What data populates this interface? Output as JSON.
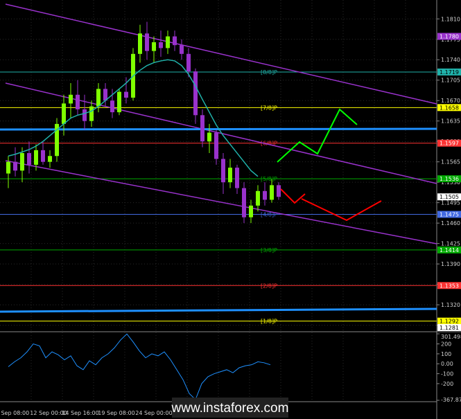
{
  "watermark": "www.instaforex.com",
  "colors": {
    "background": "#000000",
    "grid": "#2a2a2a",
    "bull_candle": "#7fff00",
    "bear_candle": "#9932cc",
    "ma": "#20b2aa",
    "channel": "#9932cc",
    "hline": "#1e90ff",
    "arrow_up": "#00ff00",
    "arrow_down": "#ff0000",
    "cci_line": "#1e90ff"
  },
  "chart_data": {
    "type": "candlestick",
    "price_axis": {
      "ticks": [
        "1.1810",
        "1.1775",
        "1.1740",
        "1.1705",
        "1.1670",
        "1.1635",
        "1.1600",
        "1.1565",
        "1.1530",
        "1.1495",
        "1.1460",
        "1.1425",
        "1.1390",
        "1.1355",
        "1.1320",
        "1.1285"
      ],
      "range": [
        1.1275,
        1.184
      ]
    },
    "time_axis": {
      "ticks": [
        "6 Sep 08:00",
        "12 Sep 00:00",
        "14 Sep 16:00",
        "19 Sep 08:00",
        "24 Sep 00:00"
      ]
    },
    "murray_levels": [
      {
        "label": "[8/8]P",
        "price": 1.1719,
        "color": "#20b2aa",
        "tag": "1.1719"
      },
      {
        "label": "[7/8]P",
        "price": 1.1658,
        "color": "#ffff00",
        "tag": "1.1658"
      },
      {
        "label": "[6/8]P",
        "price": 1.1597,
        "color": "#ff3333",
        "tag": "1.1597"
      },
      {
        "label": "[5/8]P",
        "price": 1.1536,
        "color": "#00aa00",
        "tag": "1.1536"
      },
      {
        "label": "[4/8]P",
        "price": 1.1475,
        "color": "#4169e1",
        "tag": "1.1475"
      },
      {
        "label": "[3/8]P",
        "price": 1.1414,
        "color": "#00aa00",
        "tag": "1.1414"
      },
      {
        "label": "[2/8]P",
        "price": 1.1353,
        "color": "#ff3333",
        "tag": "1.1353"
      },
      {
        "label": "[1/8]P",
        "price": 1.1292,
        "color": "#ffff00",
        "tag": "1.1292"
      }
    ],
    "extra_tags": [
      {
        "price": 1.178,
        "text": "1.1780",
        "color": "#9932cc"
      },
      {
        "price": 1.1505,
        "text": "1.1505",
        "color": "#ffffff"
      },
      {
        "price": 1.1281,
        "text": "1.1281",
        "color": "#ffffff"
      }
    ],
    "candles": [
      {
        "o": 1.1545,
        "h": 1.1575,
        "l": 1.152,
        "c": 1.1565
      },
      {
        "o": 1.1565,
        "h": 1.159,
        "l": 1.154,
        "c": 1.155
      },
      {
        "o": 1.155,
        "h": 1.159,
        "l": 1.153,
        "c": 1.158
      },
      {
        "o": 1.158,
        "h": 1.16,
        "l": 1.1545,
        "c": 1.156
      },
      {
        "o": 1.156,
        "h": 1.1595,
        "l": 1.155,
        "c": 1.1585
      },
      {
        "o": 1.1585,
        "h": 1.16,
        "l": 1.156,
        "c": 1.1565
      },
      {
        "o": 1.1565,
        "h": 1.1585,
        "l": 1.1555,
        "c": 1.1575
      },
      {
        "o": 1.1575,
        "h": 1.164,
        "l": 1.1565,
        "c": 1.163
      },
      {
        "o": 1.163,
        "h": 1.168,
        "l": 1.161,
        "c": 1.1665
      },
      {
        "o": 1.1665,
        "h": 1.17,
        "l": 1.164,
        "c": 1.168
      },
      {
        "o": 1.168,
        "h": 1.1705,
        "l": 1.1645,
        "c": 1.1655
      },
      {
        "o": 1.1655,
        "h": 1.168,
        "l": 1.162,
        "c": 1.1635
      },
      {
        "o": 1.1635,
        "h": 1.167,
        "l": 1.1625,
        "c": 1.166
      },
      {
        "o": 1.166,
        "h": 1.17,
        "l": 1.165,
        "c": 1.169
      },
      {
        "o": 1.169,
        "h": 1.17,
        "l": 1.166,
        "c": 1.167
      },
      {
        "o": 1.167,
        "h": 1.169,
        "l": 1.164,
        "c": 1.165
      },
      {
        "o": 1.165,
        "h": 1.169,
        "l": 1.1645,
        "c": 1.1685
      },
      {
        "o": 1.1685,
        "h": 1.171,
        "l": 1.1665,
        "c": 1.1675
      },
      {
        "o": 1.1675,
        "h": 1.176,
        "l": 1.167,
        "c": 1.175
      },
      {
        "o": 1.175,
        "h": 1.18,
        "l": 1.1735,
        "c": 1.1785
      },
      {
        "o": 1.1785,
        "h": 1.1805,
        "l": 1.174,
        "c": 1.1755
      },
      {
        "o": 1.1755,
        "h": 1.178,
        "l": 1.1735,
        "c": 1.177
      },
      {
        "o": 1.177,
        "h": 1.179,
        "l": 1.1745,
        "c": 1.176
      },
      {
        "o": 1.176,
        "h": 1.179,
        "l": 1.175,
        "c": 1.178
      },
      {
        "o": 1.178,
        "h": 1.179,
        "l": 1.1755,
        "c": 1.1765
      },
      {
        "o": 1.1765,
        "h": 1.1775,
        "l": 1.174,
        "c": 1.175
      },
      {
        "o": 1.175,
        "h": 1.176,
        "l": 1.171,
        "c": 1.172
      },
      {
        "o": 1.172,
        "h": 1.1725,
        "l": 1.163,
        "c": 1.1645
      },
      {
        "o": 1.1645,
        "h": 1.1655,
        "l": 1.159,
        "c": 1.16
      },
      {
        "o": 1.16,
        "h": 1.163,
        "l": 1.158,
        "c": 1.1615
      },
      {
        "o": 1.1615,
        "h": 1.162,
        "l": 1.156,
        "c": 1.157
      },
      {
        "o": 1.157,
        "h": 1.158,
        "l": 1.151,
        "c": 1.153
      },
      {
        "o": 1.153,
        "h": 1.157,
        "l": 1.152,
        "c": 1.1555
      },
      {
        "o": 1.1555,
        "h": 1.156,
        "l": 1.151,
        "c": 1.152
      },
      {
        "o": 1.152,
        "h": 1.153,
        "l": 1.146,
        "c": 1.147
      },
      {
        "o": 1.147,
        "h": 1.15,
        "l": 1.146,
        "c": 1.149
      },
      {
        "o": 1.149,
        "h": 1.1525,
        "l": 1.148,
        "c": 1.1515
      },
      {
        "o": 1.1515,
        "h": 1.153,
        "l": 1.149,
        "c": 1.15
      },
      {
        "o": 1.15,
        "h": 1.1535,
        "l": 1.1495,
        "c": 1.1525
      },
      {
        "o": 1.1525,
        "h": 1.153,
        "l": 1.15,
        "c": 1.1505
      }
    ],
    "moving_average": [
      1.1575,
      1.1578,
      1.1582,
      1.1586,
      1.1592,
      1.16,
      1.161,
      1.162,
      1.163,
      1.164,
      1.1645,
      1.1648,
      1.1652,
      1.166,
      1.167,
      1.168,
      1.169,
      1.17,
      1.1712,
      1.1722,
      1.173,
      1.1735,
      1.1738,
      1.174,
      1.1738,
      1.173,
      1.1715,
      1.1695,
      1.1672,
      1.165,
      1.1628,
      1.161,
      1.1595,
      1.158,
      1.1565,
      1.155,
      1.154
    ],
    "cci": {
      "ticks": [
        "301.498",
        "200",
        "100",
        "0.00",
        "-100",
        "-200",
        "-367.870"
      ],
      "range": [
        -367.87,
        301.498
      ],
      "values": [
        -30,
        20,
        60,
        120,
        200,
        180,
        60,
        120,
        90,
        40,
        80,
        -20,
        -60,
        30,
        -10,
        60,
        100,
        160,
        240,
        300,
        220,
        130,
        60,
        100,
        80,
        120,
        40,
        -60,
        -160,
        -300,
        -360,
        -200,
        -130,
        -100,
        -80,
        -60,
        -90,
        -40,
        -20,
        -10,
        20,
        10,
        -10
      ]
    }
  }
}
